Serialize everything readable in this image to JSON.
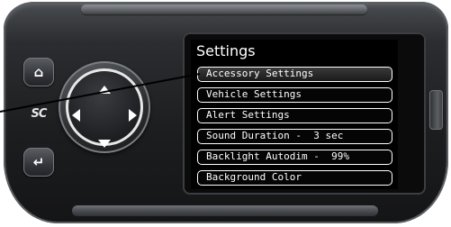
{
  "screen": {
    "title": "Settings",
    "menu_items": [
      {
        "label": "Accessory Settings",
        "selected": true
      },
      {
        "label": "Vehicle Settings",
        "selected": false
      },
      {
        "label": "Alert Settings",
        "selected": false
      },
      {
        "label": "Sound Duration -  3 sec",
        "selected": false
      },
      {
        "label": "Backlight Autodim -  99%",
        "selected": false
      },
      {
        "label": "Background Color",
        "selected": false
      }
    ]
  },
  "device": {
    "logo_text": "SC",
    "home_button_icon": "home-icon",
    "back_button_icon": "return-arrow-icon",
    "dpad_icons": [
      "arrow-up-icon",
      "arrow-down-icon",
      "arrow-left-icon",
      "arrow-right-icon"
    ]
  },
  "colors": {
    "screen_background": "#000000",
    "screen_text": "#ffffff",
    "device_body": "#1c1d1f"
  }
}
